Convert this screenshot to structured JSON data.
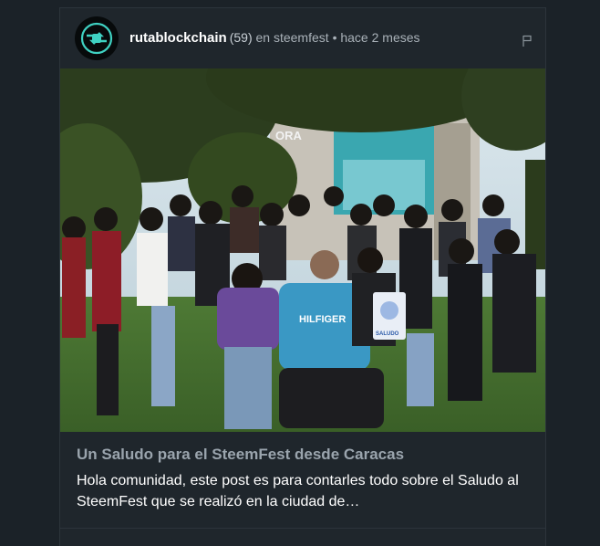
{
  "post": {
    "author": "rutablockchain",
    "reputation": "(59)",
    "in_text": "en",
    "community": "steemfest",
    "separator": "•",
    "time": "hace 2 meses",
    "title": "Un Saludo para el SteemFest desde Caracas",
    "excerpt": "Hola comunidad, este post es para contarles todo sobre el Saludo al SteemFest que se realizó en la ciudad de…",
    "image": {
      "building_sign": "ORA",
      "shirt_text": "HILFIGER",
      "sign_text": "SALUDO"
    }
  },
  "icons": {
    "avatar": "ruta-blockchain-logo-icon",
    "flag": "flag-icon"
  },
  "colors": {
    "background": "#1b2228",
    "card": "#1f262c",
    "accent_teal": "#3fd1c2"
  }
}
